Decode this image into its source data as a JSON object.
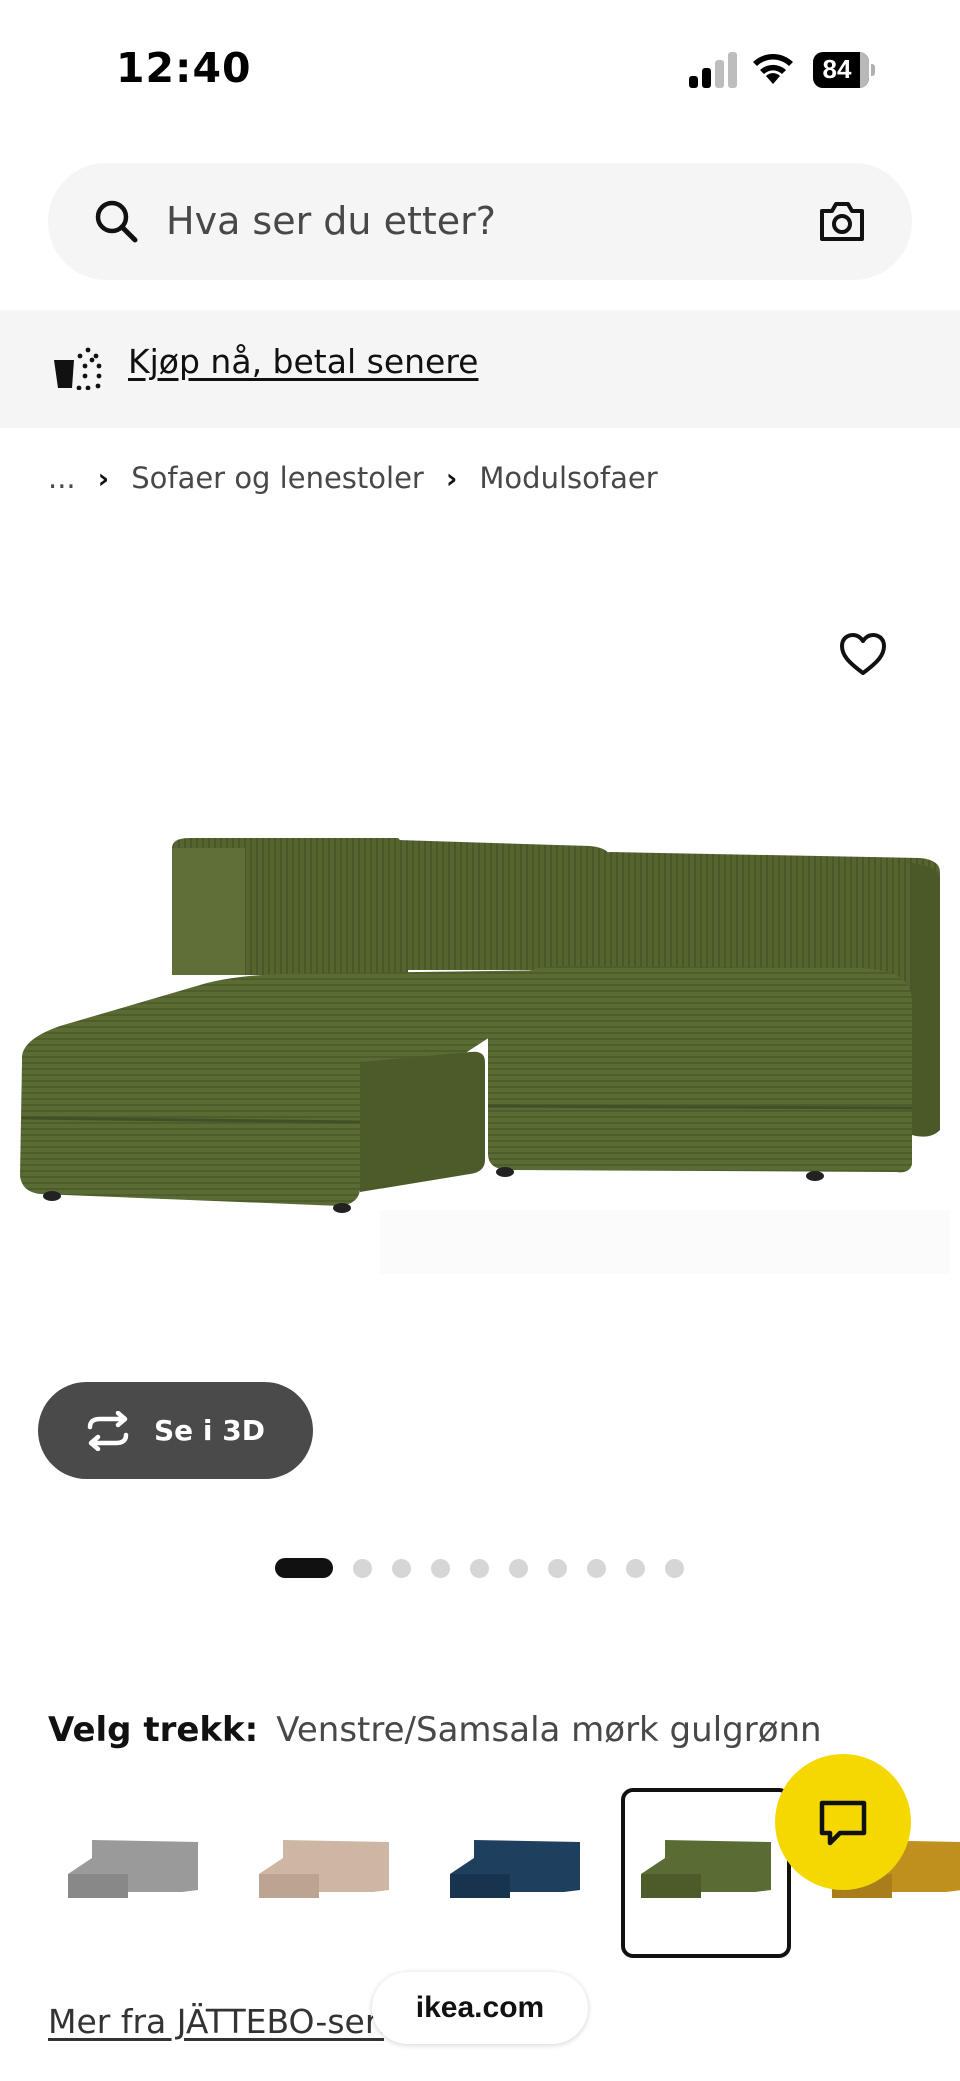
{
  "status_bar": {
    "time": "12:40",
    "battery": "84",
    "icons": [
      "signal-icon",
      "wifi-icon",
      "battery-icon"
    ]
  },
  "search": {
    "placeholder": "Hva ser du etter?",
    "value": "",
    "icons": [
      "search-icon",
      "camera-icon"
    ]
  },
  "promo": {
    "link_label": "Kjøp nå, betal senere",
    "icon": "bag-icon"
  },
  "breadcrumb": {
    "items": [
      "...",
      "Sofaer og lenestoler",
      "Modulsofaer"
    ],
    "separator_icon": "chevron-right-icon"
  },
  "product": {
    "favorite_icon": "heart-icon",
    "view_3d_label": "Se i 3D",
    "view_3d_icon": "rotate-3d-icon",
    "image_count": 10,
    "active_image": 1
  },
  "variant": {
    "label": "Velg trekk:",
    "value": "Venstre/Samsala mørk gulgrønn",
    "swatches": [
      {
        "name": "light-grey",
        "color": "#9a9a9a"
      },
      {
        "name": "beige",
        "color": "#cdb7a4"
      },
      {
        "name": "dark-blue",
        "color": "#1f3f5e"
      },
      {
        "name": "dark-yellow-green",
        "color": "#5b6b34"
      },
      {
        "name": "mustard",
        "color": "#c0901f"
      }
    ],
    "selected_index": 3
  },
  "chat": {
    "icon": "chat-icon",
    "color": "#f5d800"
  },
  "footer": {
    "more_link": "Mer fra JÄTTEBO-serien",
    "url": "ikea.com"
  },
  "colors": {
    "sofa": "#5b6b34",
    "sofa_dark": "#46532a",
    "pill_bg": "#4a4a4a",
    "banner_bg": "#f5f5f5"
  }
}
